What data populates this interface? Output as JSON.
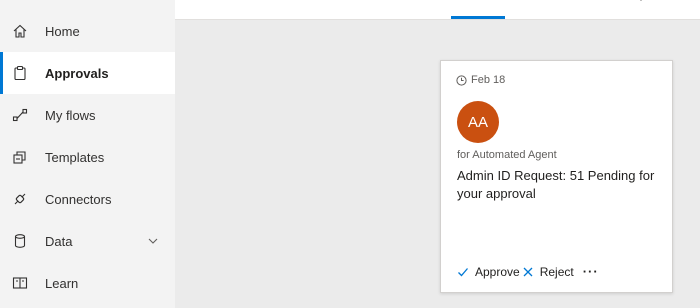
{
  "sidebar": {
    "items": [
      {
        "label": "Home",
        "icon": "home-icon"
      },
      {
        "label": "Approvals",
        "icon": "clipboard-icon",
        "active": true
      },
      {
        "label": "My flows",
        "icon": "flow-icon"
      },
      {
        "label": "Templates",
        "icon": "templates-icon"
      },
      {
        "label": "Connectors",
        "icon": "connector-icon"
      },
      {
        "label": "Data",
        "icon": "database-icon",
        "expandable": true
      },
      {
        "label": "Learn",
        "icon": "book-icon"
      }
    ]
  },
  "card": {
    "date": "Feb 18",
    "avatar_initials": "AA",
    "for_text": "for Automated Agent",
    "title": "Admin ID Request: 51 Pending for your approval",
    "approve_label": "Approve",
    "reject_label": "Reject",
    "more_label": "···"
  },
  "colors": {
    "accent": "#0078d4",
    "avatar": "#ca5010",
    "sidebar_bg": "#f3f3f3",
    "page_bg": "#ebebeb"
  }
}
